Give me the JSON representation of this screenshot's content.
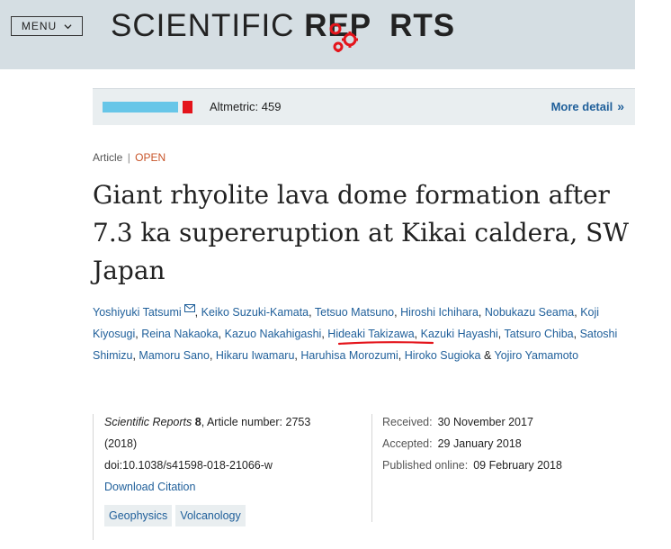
{
  "header": {
    "menu_label": "MENU",
    "brand_light": "SCIENTIFIC ",
    "brand_bold": "REP",
    "brand_tail": "RTS",
    "colors": {
      "background": "#d5dee3"
    }
  },
  "altmetric": {
    "score_text": "Altmetric: 459",
    "more_detail": "More detail",
    "chevrons": "»",
    "colors": {
      "blue": "#67c6e8",
      "red": "#e4141b"
    }
  },
  "article": {
    "type": "Article",
    "separator": "|",
    "access": "OPEN",
    "title": "Giant rhyolite lava dome formation after 7.3 ka supereruption at Kikai caldera, SW Japan"
  },
  "authors": [
    "Yoshiyuki Tatsumi",
    "Keiko Suzuki-Kamata",
    "Tetsuo Matsuno",
    "Hiroshi Ichihara",
    "Nobukazu Seama",
    "Koji Kiyosugi",
    "Reina Nakaoka",
    "Kazuo Nakahigashi",
    "Hideaki Takizawa",
    "Kazuki Hayashi",
    "Tatsuro Chiba",
    "Satoshi Shimizu",
    "Mamoru Sano",
    "Hikaru Iwamaru",
    "Haruhisa Morozumi",
    "Hiroko Sugioka",
    "Yojiro Yamamoto"
  ],
  "citation": {
    "journal": "Scientific Reports",
    "volume": "8",
    "article_number_text": ", Article number: 2753",
    "year": "(2018)",
    "doi": "doi:10.1038/s41598-018-21066-w",
    "download": "Download Citation"
  },
  "subjects": [
    "Geophysics",
    "Volcanology"
  ],
  "dates": {
    "received_label": "Received:",
    "received": "30 November 2017",
    "accepted_label": "Accepted:",
    "accepted": "29 January 2018",
    "published_label": "Published online:",
    "published": "09 February 2018"
  }
}
